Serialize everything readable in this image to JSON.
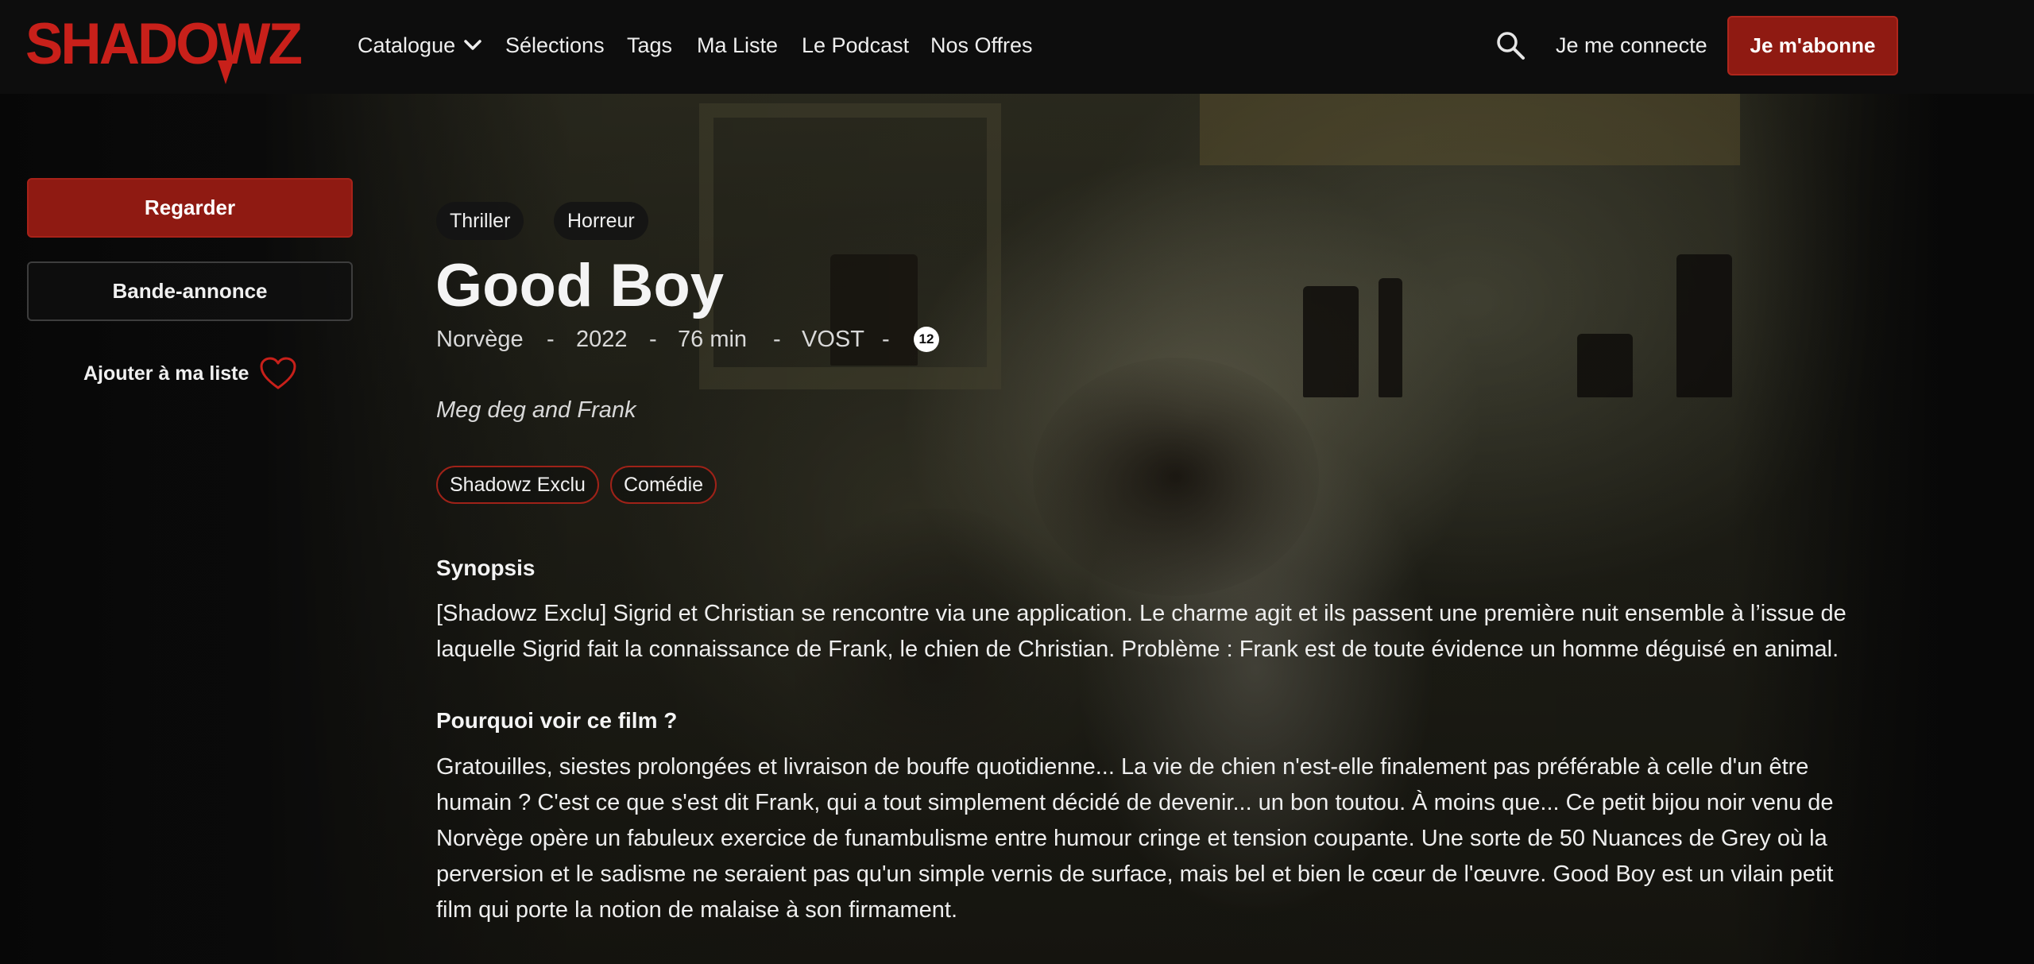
{
  "brand": {
    "name": "SHADOWZ",
    "red": "#c8201a",
    "button_red": "#8f1a12"
  },
  "nav": {
    "items": [
      "Catalogue",
      "Sélections",
      "Tags",
      "Ma Liste",
      "Le Podcast",
      "Nos Offres"
    ],
    "catalogue_has_dropdown": true,
    "search_icon": "search-icon",
    "login_label": "Je me connecte",
    "subscribe_label": "Je m'abonne"
  },
  "sidebar": {
    "watch_label": "Regarder",
    "trailer_label": "Bande-annonce",
    "add_list_label": "Ajouter à ma liste",
    "add_list_icon": "heart-icon"
  },
  "film": {
    "genres": [
      "Thriller",
      "Horreur"
    ],
    "title": "Good Boy",
    "meta": {
      "country": "Norvège",
      "year": "2022",
      "duration": "76 min",
      "version": "VOST",
      "separator": "-",
      "age_rating": "12"
    },
    "tagline": "Meg deg and Frank",
    "tags": [
      "Shadowz Exclu",
      "Comédie"
    ],
    "synopsis_heading": "Synopsis",
    "synopsis_lines": [
      "[Shadowz Exclu] Sigrid et Christian se rencontre via une application. Le charme agit et ils passent une première nuit ensemble à l’issue de",
      "laquelle Sigrid fait la connaissance de Frank, le chien de Christian. Problème : Frank est de toute évidence un homme déguisé en animal."
    ],
    "why_heading": "Pourquoi voir ce film ?",
    "why_lines": [
      "Gratouilles, siestes prolongées et livraison de bouffe quotidienne... La vie de chien n'est-elle finalement pas préférable à celle d'un être",
      "humain ? C'est ce que s'est dit Frank, qui a tout simplement décidé de devenir... un bon toutou. À moins que... Ce petit bijou noir venu de",
      "Norvège opère un fabuleux exercice de funambulisme entre humour cringe et tension coupante. Une sorte de 50 Nuances de Grey où la",
      "perversion et le sadisme ne seraient pas qu'un simple vernis de surface, mais bel et bien le cœur de l'œuvre. Good Boy est un vilain petit",
      "film qui porte la notion de malaise à son firmament."
    ]
  }
}
